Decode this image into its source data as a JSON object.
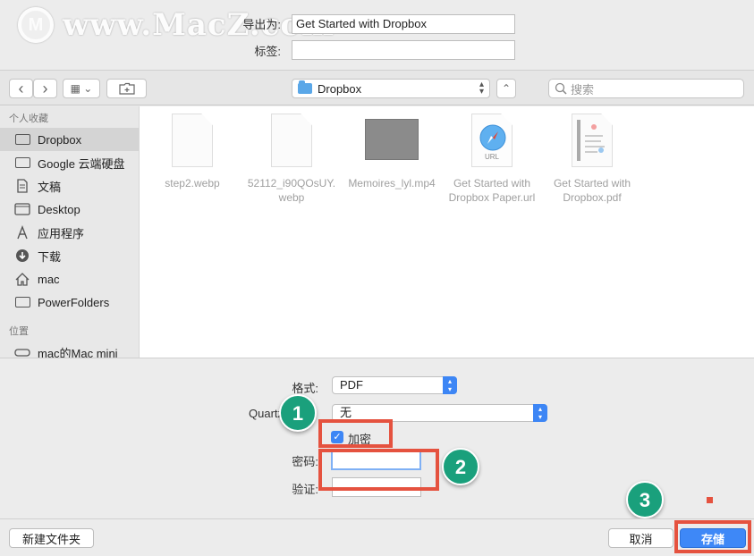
{
  "watermark": {
    "text": "www.MacZ.com",
    "logo_letter": "M"
  },
  "top_form": {
    "export_label": "导出为:",
    "filename_value": "Get Started with Dropbox",
    "tags_label": "标签:",
    "tags_value": ""
  },
  "toolbar": {
    "back_icon": "‹",
    "forward_icon": "›",
    "view_icon": "▦ ⌄",
    "location": "Dropbox",
    "location_arrows": "⌃⌄",
    "expand_icon": "⌃",
    "search_placeholder": "搜索"
  },
  "sidebar": {
    "favorites_header": "个人收藏",
    "items": [
      {
        "label": "Dropbox",
        "icon": "folder-icon"
      },
      {
        "label": "Google 云端硬盘",
        "icon": "folder-icon"
      },
      {
        "label": "文稿",
        "icon": "document-icon"
      },
      {
        "label": "Desktop",
        "icon": "desktop-icon"
      },
      {
        "label": "应用程序",
        "icon": "applications-icon"
      },
      {
        "label": "下载",
        "icon": "download-icon"
      },
      {
        "label": "mac",
        "icon": "home-icon"
      },
      {
        "label": "PowerFolders",
        "icon": "folder-icon"
      }
    ],
    "locations_header": "位置",
    "locations": [
      {
        "label": "mac的Mac mini",
        "icon": "computer-icon"
      }
    ]
  },
  "files": [
    {
      "name_line1": "step2.webp",
      "name_line2": "",
      "kind": "document"
    },
    {
      "name_line1": "52112_i90QOsUY.",
      "name_line2": "webp",
      "kind": "document"
    },
    {
      "name_line1": "Memoires_lyl.mp4",
      "name_line2": "",
      "kind": "video"
    },
    {
      "name_line1": "Get Started with",
      "name_line2": "Dropbox Paper.url",
      "kind": "url",
      "badge": "URL"
    },
    {
      "name_line1": "Get Started with",
      "name_line2": "Dropbox.pdf",
      "kind": "pdf"
    }
  ],
  "options": {
    "format_label": "格式:",
    "format_value": "PDF",
    "quartz_label": "Quartz",
    "quartz_value": "无",
    "encrypt_label": "加密",
    "encrypt_checked": true,
    "password_label": "密码:",
    "verify_label": "验证:"
  },
  "annotations": {
    "badge1": "1",
    "badge2": "2",
    "badge3": "3"
  },
  "footer": {
    "new_folder": "新建文件夹",
    "cancel": "取消",
    "save": "存储"
  },
  "colors": {
    "accent": "#3e88f7",
    "annotation_red": "#e5523f",
    "badge_green": "#1aa07c"
  }
}
